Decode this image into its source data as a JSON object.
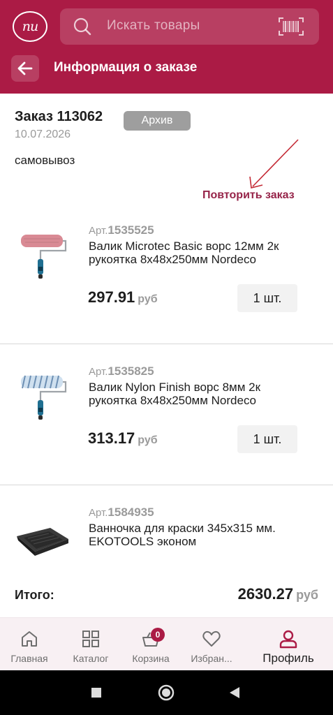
{
  "header": {
    "logo_text": "пи",
    "search_placeholder": "Искать товары",
    "title": "Информация о заказе"
  },
  "order": {
    "number": "Заказ 113062",
    "status": "Архив",
    "date": "10.07.2026",
    "delivery": "самовывоз",
    "repeat_label": "Повторить заказ"
  },
  "items": [
    {
      "art_prefix": "Арт.",
      "art": "1535525",
      "name": "Валик Microtec Basic ворс 12мм 2к рукоятка 8х48х250мм Nordeco",
      "price": "297.91",
      "currency": "руб",
      "qty": "1 шт.",
      "roller_color": "#d98a94"
    },
    {
      "art_prefix": "Арт.",
      "art": "1535825",
      "name": "Валик Nylon Finish ворс 8мм  2к рукоятка 8х48х250мм Nordeco",
      "price": "313.17",
      "currency": "руб",
      "qty": "1 шт.",
      "roller_color": "#cfe0ef"
    },
    {
      "art_prefix": "Арт.",
      "art": "1584935",
      "name": "Ванночка для краски 345х315 мм. EKOTOOLS эконом"
    }
  ],
  "total": {
    "label": "Итого:",
    "value": "2630.27",
    "currency": "руб"
  },
  "nav": {
    "home": "Главная",
    "catalog": "Каталог",
    "cart": "Корзина",
    "cart_count": "0",
    "favorites": "Избран...",
    "profile": "Профиль"
  },
  "colors": {
    "brand": "#ab1b45",
    "accent_text": "#962449"
  }
}
